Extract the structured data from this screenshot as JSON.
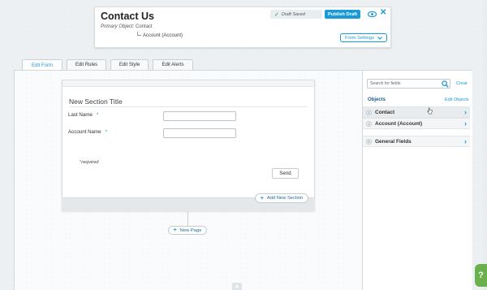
{
  "header": {
    "title": "Contact Us",
    "primary_object_label": "Primary Object:",
    "primary_object_value": "Contact",
    "associated_object": "Account (Account)",
    "draft_status": "Draft Saved",
    "publish_label": "Publish Draft",
    "form_settings_label": "Form Settings"
  },
  "tabs": [
    {
      "label": "Edit Form",
      "active": true
    },
    {
      "label": "Edit Rules",
      "active": false
    },
    {
      "label": "Edit Style",
      "active": false
    },
    {
      "label": "Edit Alerts",
      "active": false
    }
  ],
  "form": {
    "section_title": "New Section Title",
    "fields": [
      {
        "label": "Last Name",
        "required_mark": "*",
        "value": ""
      },
      {
        "label": "Account Name",
        "required_mark": "*",
        "value": ""
      }
    ],
    "required_note_mark": "*",
    "required_note": "required",
    "submit_label": "Send",
    "add_section_label": "Add New Section",
    "add_page_label": "New Page"
  },
  "sidebar": {
    "search_placeholder": "Search for fields",
    "clear_label": "Clear",
    "objects_heading": "Objects",
    "edit_objects_label": "Edit Objects",
    "objects": [
      {
        "num": "1",
        "name": "Contact"
      },
      {
        "num": "2",
        "name": "Account (Account)"
      }
    ],
    "general": {
      "num": "G",
      "name": "General Fields"
    }
  },
  "help_label": "?",
  "colors": {
    "accent": "#1a9ad6",
    "help": "#6ab04c"
  }
}
